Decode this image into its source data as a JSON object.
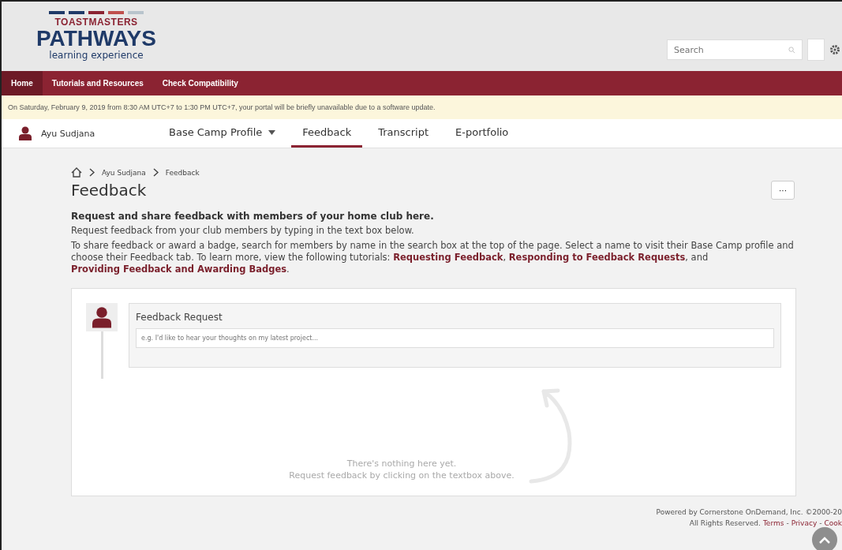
{
  "logo": {
    "brand": "TOASTMASTERS",
    "name": "PATHWAYS",
    "tagline": "learning experience"
  },
  "search": {
    "placeholder": "Search"
  },
  "nav": [
    {
      "label": "Home",
      "selected": true
    },
    {
      "label": "Tutorials and Resources",
      "selected": false
    },
    {
      "label": "Check Compatibility",
      "selected": false
    }
  ],
  "notice": "On Saturday, February 9, 2019 from 8:30 AM UTC+7 to 1:30 PM UTC+7, your portal will be briefly unavailable due to a software update.",
  "user": {
    "name": "Ayu Sudjana"
  },
  "tabs": [
    {
      "label": "Base Camp Profile",
      "selected": false,
      "kind": "dropdown"
    },
    {
      "label": "Feedback",
      "selected": true,
      "kind": "plain"
    },
    {
      "label": "Transcript",
      "selected": false,
      "kind": "plain"
    },
    {
      "label": "E-portfolio",
      "selected": false,
      "kind": "plain"
    }
  ],
  "breadcrumb": [
    "Ayu Sudjana",
    "Feedback"
  ],
  "title": "Feedback",
  "more_button": "···",
  "intro": "Request and share feedback with members of your home club here.",
  "subintro": "Request feedback from your club members by typing in the text box below.",
  "description": [
    {
      "kind": "text",
      "text": "To share feedback or award a badge, search for members by name in the search box at the top of the page. Select a name to visit their Base Camp profile and choose their Feedback tab. To learn more, view the following tutorials: "
    },
    {
      "kind": "link",
      "text": "Requesting Feedback"
    },
    {
      "kind": "text",
      "text": ", "
    },
    {
      "kind": "link",
      "text": "Responding to Feedback Requests"
    },
    {
      "kind": "text",
      "text": ", and "
    },
    {
      "kind": "link",
      "text": "Providing Feedback and Awarding Badges"
    },
    {
      "kind": "text",
      "text": "."
    }
  ],
  "request": {
    "label": "Feedback Request",
    "placeholder": "e.g. I'd like to hear your thoughts on my latest project..."
  },
  "empty": [
    "There's nothing here yet.",
    "Request feedback by clicking on the textbox above."
  ],
  "footer": {
    "line1": "Powered by Cornerstone OnDemand, Inc. ©2000-20",
    "line2": "All Rights Reserved.",
    "links": [
      "Terms",
      "Privacy",
      "Cook"
    ],
    "separator": "-"
  }
}
